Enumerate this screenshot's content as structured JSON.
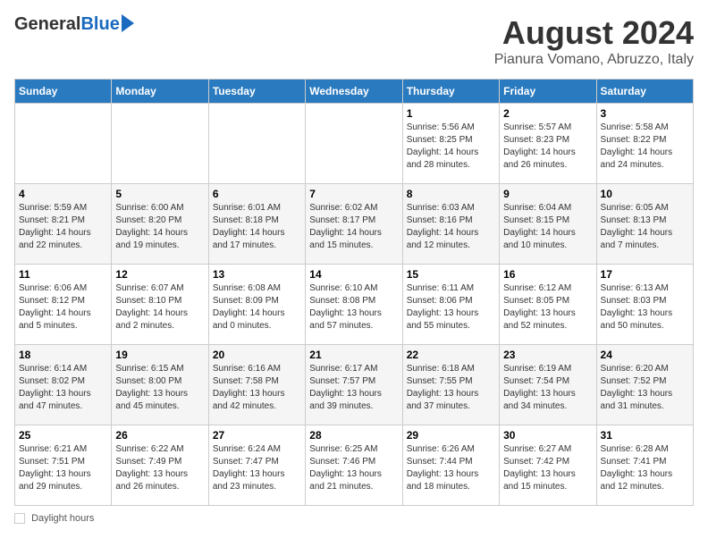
{
  "header": {
    "logo_general": "General",
    "logo_blue": "Blue",
    "month_year": "August 2024",
    "location": "Pianura Vomano, Abruzzo, Italy"
  },
  "weekdays": [
    "Sunday",
    "Monday",
    "Tuesday",
    "Wednesday",
    "Thursday",
    "Friday",
    "Saturday"
  ],
  "weeks": [
    [
      {
        "day": "",
        "info": ""
      },
      {
        "day": "",
        "info": ""
      },
      {
        "day": "",
        "info": ""
      },
      {
        "day": "",
        "info": ""
      },
      {
        "day": "1",
        "info": "Sunrise: 5:56 AM\nSunset: 8:25 PM\nDaylight: 14 hours and 28 minutes."
      },
      {
        "day": "2",
        "info": "Sunrise: 5:57 AM\nSunset: 8:23 PM\nDaylight: 14 hours and 26 minutes."
      },
      {
        "day": "3",
        "info": "Sunrise: 5:58 AM\nSunset: 8:22 PM\nDaylight: 14 hours and 24 minutes."
      }
    ],
    [
      {
        "day": "4",
        "info": "Sunrise: 5:59 AM\nSunset: 8:21 PM\nDaylight: 14 hours and 22 minutes."
      },
      {
        "day": "5",
        "info": "Sunrise: 6:00 AM\nSunset: 8:20 PM\nDaylight: 14 hours and 19 minutes."
      },
      {
        "day": "6",
        "info": "Sunrise: 6:01 AM\nSunset: 8:18 PM\nDaylight: 14 hours and 17 minutes."
      },
      {
        "day": "7",
        "info": "Sunrise: 6:02 AM\nSunset: 8:17 PM\nDaylight: 14 hours and 15 minutes."
      },
      {
        "day": "8",
        "info": "Sunrise: 6:03 AM\nSunset: 8:16 PM\nDaylight: 14 hours and 12 minutes."
      },
      {
        "day": "9",
        "info": "Sunrise: 6:04 AM\nSunset: 8:15 PM\nDaylight: 14 hours and 10 minutes."
      },
      {
        "day": "10",
        "info": "Sunrise: 6:05 AM\nSunset: 8:13 PM\nDaylight: 14 hours and 7 minutes."
      }
    ],
    [
      {
        "day": "11",
        "info": "Sunrise: 6:06 AM\nSunset: 8:12 PM\nDaylight: 14 hours and 5 minutes."
      },
      {
        "day": "12",
        "info": "Sunrise: 6:07 AM\nSunset: 8:10 PM\nDaylight: 14 hours and 2 minutes."
      },
      {
        "day": "13",
        "info": "Sunrise: 6:08 AM\nSunset: 8:09 PM\nDaylight: 14 hours and 0 minutes."
      },
      {
        "day": "14",
        "info": "Sunrise: 6:10 AM\nSunset: 8:08 PM\nDaylight: 13 hours and 57 minutes."
      },
      {
        "day": "15",
        "info": "Sunrise: 6:11 AM\nSunset: 8:06 PM\nDaylight: 13 hours and 55 minutes."
      },
      {
        "day": "16",
        "info": "Sunrise: 6:12 AM\nSunset: 8:05 PM\nDaylight: 13 hours and 52 minutes."
      },
      {
        "day": "17",
        "info": "Sunrise: 6:13 AM\nSunset: 8:03 PM\nDaylight: 13 hours and 50 minutes."
      }
    ],
    [
      {
        "day": "18",
        "info": "Sunrise: 6:14 AM\nSunset: 8:02 PM\nDaylight: 13 hours and 47 minutes."
      },
      {
        "day": "19",
        "info": "Sunrise: 6:15 AM\nSunset: 8:00 PM\nDaylight: 13 hours and 45 minutes."
      },
      {
        "day": "20",
        "info": "Sunrise: 6:16 AM\nSunset: 7:58 PM\nDaylight: 13 hours and 42 minutes."
      },
      {
        "day": "21",
        "info": "Sunrise: 6:17 AM\nSunset: 7:57 PM\nDaylight: 13 hours and 39 minutes."
      },
      {
        "day": "22",
        "info": "Sunrise: 6:18 AM\nSunset: 7:55 PM\nDaylight: 13 hours and 37 minutes."
      },
      {
        "day": "23",
        "info": "Sunrise: 6:19 AM\nSunset: 7:54 PM\nDaylight: 13 hours and 34 minutes."
      },
      {
        "day": "24",
        "info": "Sunrise: 6:20 AM\nSunset: 7:52 PM\nDaylight: 13 hours and 31 minutes."
      }
    ],
    [
      {
        "day": "25",
        "info": "Sunrise: 6:21 AM\nSunset: 7:51 PM\nDaylight: 13 hours and 29 minutes."
      },
      {
        "day": "26",
        "info": "Sunrise: 6:22 AM\nSunset: 7:49 PM\nDaylight: 13 hours and 26 minutes."
      },
      {
        "day": "27",
        "info": "Sunrise: 6:24 AM\nSunset: 7:47 PM\nDaylight: 13 hours and 23 minutes."
      },
      {
        "day": "28",
        "info": "Sunrise: 6:25 AM\nSunset: 7:46 PM\nDaylight: 13 hours and 21 minutes."
      },
      {
        "day": "29",
        "info": "Sunrise: 6:26 AM\nSunset: 7:44 PM\nDaylight: 13 hours and 18 minutes."
      },
      {
        "day": "30",
        "info": "Sunrise: 6:27 AM\nSunset: 7:42 PM\nDaylight: 13 hours and 15 minutes."
      },
      {
        "day": "31",
        "info": "Sunrise: 6:28 AM\nSunset: 7:41 PM\nDaylight: 13 hours and 12 minutes."
      }
    ]
  ],
  "footer": {
    "daylight_label": "Daylight hours"
  }
}
